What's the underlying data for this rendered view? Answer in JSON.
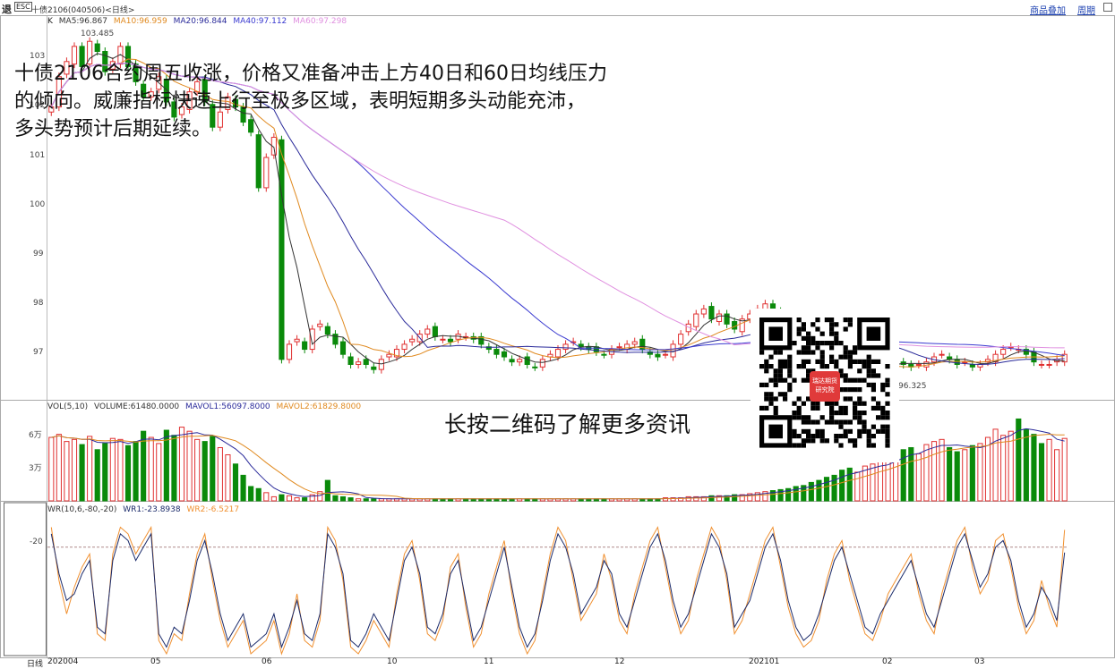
{
  "header": {
    "back_label": "退",
    "esc_label": "ESC",
    "symbol_text": "十债2106(040506)<日线>",
    "overlay_button": "商品叠加",
    "period_button": "周期"
  },
  "annotation": {
    "lines": [
      "十债2106合约周五收涨，价格又准备冲击上方40日和60日均线压力",
      "的倾向。威廉指标快速上行至极多区域，表明短期多头动能充沛，",
      "多头势预计后期延续。"
    ],
    "qr_prompt": "长按二维码了解更多资讯",
    "qr_center_text": "瑞达期货研究院"
  },
  "price_panel": {
    "legend_k": "K",
    "ma_labels": [
      "MA5:96.867",
      "MA10:96.959",
      "MA20:96.844",
      "MA40:97.112",
      "MA60:97.298"
    ],
    "high_label": "103.485",
    "low_label": "96.325",
    "y_ticks": [
      "103",
      "102",
      "101",
      "100",
      "99",
      "98",
      "97"
    ]
  },
  "volume_panel": {
    "legend": [
      "VOL(5,10)",
      "VOLUME:61480.0000",
      "MAVOL1:56097.8000",
      "MAVOL2:61829.8000"
    ],
    "y_ticks": [
      "6万",
      "3万"
    ]
  },
  "wr_panel": {
    "legend": [
      "WR(10,6,-80,-20)",
      "WR1:-23.8938",
      "WR2:-6.5217"
    ],
    "y_ticks": [
      "-20"
    ]
  },
  "x_axis": {
    "period_label": "日线",
    "ticks": [
      "202004",
      "05",
      "06",
      "10",
      "11",
      "12",
      "202101",
      "02",
      "03"
    ]
  },
  "colors": {
    "up": "#e03030",
    "down": "#0a8a0a",
    "ma5": "#333333",
    "ma10": "#e08a20",
    "ma20": "#2a2a9a",
    "ma40": "#3a3ad0",
    "ma60": "#e090e0",
    "wr1": "#1a2a6a",
    "wr2": "#f09030"
  },
  "chart_data": {
    "type": "candlestick",
    "title": "十债2106(040506)<日线>",
    "y_range": [
      96.2,
      103.8
    ],
    "segments_note": "",
    "closes": [
      102.0,
      102.6,
      102.9,
      103.2,
      102.8,
      103.3,
      103.1,
      102.7,
      102.9,
      103.2,
      102.8,
      102.5,
      102.2,
      102.3,
      102.6,
      102.1,
      101.8,
      102.0,
      102.3,
      102.5,
      102.1,
      101.6,
      101.9,
      102.2,
      102.0,
      101.7,
      101.5,
      100.4,
      101.0,
      101.4,
      97.0,
      97.3,
      97.4,
      97.2,
      97.6,
      97.7,
      97.5,
      97.3,
      97.1,
      96.9,
      96.95,
      96.9,
      96.8,
      97.0,
      97.1,
      97.2,
      97.3,
      97.4,
      97.5,
      97.6,
      97.45,
      97.4,
      97.35,
      97.5,
      97.45,
      97.4,
      97.3,
      97.2,
      97.1,
      97.05,
      96.95,
      97.0,
      96.9,
      96.85,
      97.0,
      97.1,
      97.2,
      97.3,
      97.35,
      97.25,
      97.2,
      97.15,
      97.1,
      97.2,
      97.25,
      97.3,
      97.35,
      97.2,
      97.1,
      97.05,
      97.1,
      97.3,
      97.5,
      97.7,
      97.9,
      98.0,
      97.8,
      97.9,
      97.7,
      97.6,
      97.8,
      97.9,
      98.0,
      98.1,
      97.9,
      97.8,
      97.6,
      97.4,
      97.3,
      97.2,
      97.1,
      97.0,
      96.9,
      96.8,
      96.7,
      96.75,
      96.8,
      96.85,
      96.9,
      96.95,
      97.0,
      96.9,
      96.85,
      96.9,
      96.95,
      97.05,
      97.1,
      97.0,
      96.9,
      96.95,
      96.85,
      96.9,
      97.0,
      97.1,
      97.2,
      97.25,
      97.2,
      97.1,
      96.95,
      96.9,
      96.9,
      97.0,
      97.1
    ],
    "volume_unit": "万",
    "volumes": [
      6.2,
      6.5,
      5.8,
      6.0,
      5.5,
      6.3,
      5.0,
      5.6,
      6.1,
      6.0,
      5.4,
      5.8,
      6.8,
      6.2,
      5.6,
      6.9,
      6.4,
      7.2,
      6.8,
      6.0,
      5.8,
      6.3,
      5.2,
      4.5,
      3.6,
      2.5,
      1.4,
      1.2,
      0.8,
      0.4,
      0.6,
      0.5,
      0.3,
      0.3,
      0.6,
      0.9,
      2.0,
      0.5,
      0.4,
      0.3,
      0.2,
      0.2,
      0.2,
      0.2,
      0.2,
      0.2,
      0.2,
      0.2,
      0.2,
      0.2,
      0.2,
      0.2,
      0.2,
      0.2,
      0.2,
      0.2,
      0.2,
      0.2,
      0.2,
      0.2,
      0.2,
      0.2,
      0.2,
      0.2,
      0.2,
      0.2,
      0.2,
      0.2,
      0.2,
      0.2,
      0.2,
      0.2,
      0.2,
      0.2,
      0.2,
      0.2,
      0.2,
      0.2,
      0.2,
      0.2,
      0.3,
      0.3,
      0.3,
      0.4,
      0.4,
      0.4,
      0.5,
      0.5,
      0.5,
      0.6,
      0.6,
      0.7,
      0.8,
      0.9,
      1.0,
      1.1,
      1.2,
      1.4,
      1.5,
      1.8,
      2.0,
      2.3,
      2.5,
      3.0,
      3.2,
      2.8,
      3.4,
      3.6,
      4.0,
      3.8,
      4.5,
      5.0,
      5.2,
      4.6,
      5.5,
      5.8,
      6.0,
      5.2,
      4.8,
      5.0,
      5.4,
      5.6,
      6.2,
      7.0,
      6.4,
      6.8,
      8.0,
      7.0,
      6.5,
      5.6,
      6.0,
      5.0,
      6.1
    ],
    "wr1": [
      -10,
      -40,
      -60,
      -55,
      -40,
      -30,
      -80,
      -85,
      -30,
      -10,
      -15,
      -30,
      -20,
      -10,
      -85,
      -95,
      -80,
      -85,
      -60,
      -30,
      -15,
      -40,
      -70,
      -90,
      -80,
      -70,
      -95,
      -90,
      -85,
      -70,
      -95,
      -80,
      -60,
      -85,
      -90,
      -70,
      -10,
      -20,
      -40,
      -90,
      -95,
      -85,
      -70,
      -80,
      -90,
      -60,
      -30,
      -20,
      -40,
      -80,
      -85,
      -70,
      -40,
      -30,
      -60,
      -90,
      -80,
      -60,
      -40,
      -20,
      -50,
      -80,
      -95,
      -85,
      -60,
      -30,
      -10,
      -20,
      -40,
      -70,
      -60,
      -50,
      -30,
      -40,
      -70,
      -80,
      -60,
      -40,
      -20,
      -10,
      -30,
      -60,
      -80,
      -70,
      -50,
      -30,
      -10,
      -20,
      -40,
      -80,
      -70,
      -60,
      -40,
      -20,
      -10,
      -30,
      -60,
      -80,
      -90,
      -85,
      -70,
      -50,
      -30,
      -20,
      -40,
      -60,
      -80,
      -85,
      -70,
      -60,
      -50,
      -40,
      -30,
      -50,
      -70,
      -80,
      -60,
      -40,
      -20,
      -10,
      -30,
      -50,
      -40,
      -20,
      -15,
      -30,
      -60,
      -80,
      -70,
      -50,
      -60,
      -75,
      -24
    ],
    "wr2": [
      -5,
      -45,
      -70,
      -50,
      -35,
      -25,
      -85,
      -90,
      -25,
      -5,
      -10,
      -25,
      -15,
      -5,
      -90,
      -100,
      -85,
      -90,
      -55,
      -25,
      -10,
      -45,
      -75,
      -95,
      -85,
      -75,
      -100,
      -95,
      -90,
      -75,
      -100,
      -85,
      -55,
      -90,
      -95,
      -75,
      -5,
      -15,
      -45,
      -95,
      -100,
      -90,
      -75,
      -85,
      -95,
      -55,
      -25,
      -15,
      -45,
      -85,
      -90,
      -75,
      -35,
      -25,
      -65,
      -95,
      -85,
      -55,
      -35,
      -15,
      -55,
      -85,
      -100,
      -90,
      -55,
      -25,
      -5,
      -15,
      -45,
      -75,
      -65,
      -55,
      -25,
      -45,
      -75,
      -85,
      -55,
      -35,
      -15,
      -5,
      -35,
      -65,
      -85,
      -75,
      -45,
      -25,
      -5,
      -15,
      -45,
      -85,
      -75,
      -55,
      -35,
      -15,
      -5,
      -35,
      -65,
      -85,
      -95,
      -90,
      -75,
      -45,
      -25,
      -15,
      -45,
      -65,
      -85,
      -90,
      -75,
      -55,
      -45,
      -35,
      -25,
      -55,
      -75,
      -85,
      -55,
      -35,
      -15,
      -5,
      -35,
      -55,
      -45,
      -15,
      -10,
      -35,
      -65,
      -85,
      -75,
      -45,
      -65,
      -80,
      -7
    ]
  }
}
